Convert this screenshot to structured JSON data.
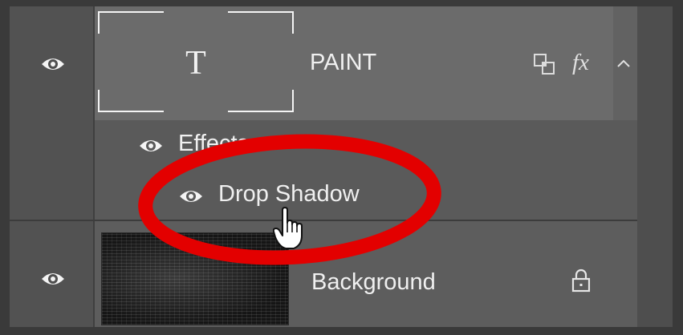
{
  "layers": [
    {
      "name": "PAINT",
      "type": "text",
      "thumbnail_glyph": "T",
      "visible": true,
      "badges": {
        "link": "linked-layers-icon",
        "fx": "fx",
        "expand": "chevron-up-icon"
      }
    },
    {
      "name": "Background",
      "type": "image",
      "visible": true,
      "locked": true
    }
  ],
  "effects": {
    "label": "Effects",
    "items": [
      {
        "label": "Drop Shadow",
        "visible": true
      }
    ]
  },
  "highlight_color": "#e30000",
  "icons": {
    "visibility": "eye-icon",
    "lock": "lock-icon",
    "cursor": "hand-pointer-cursor"
  }
}
